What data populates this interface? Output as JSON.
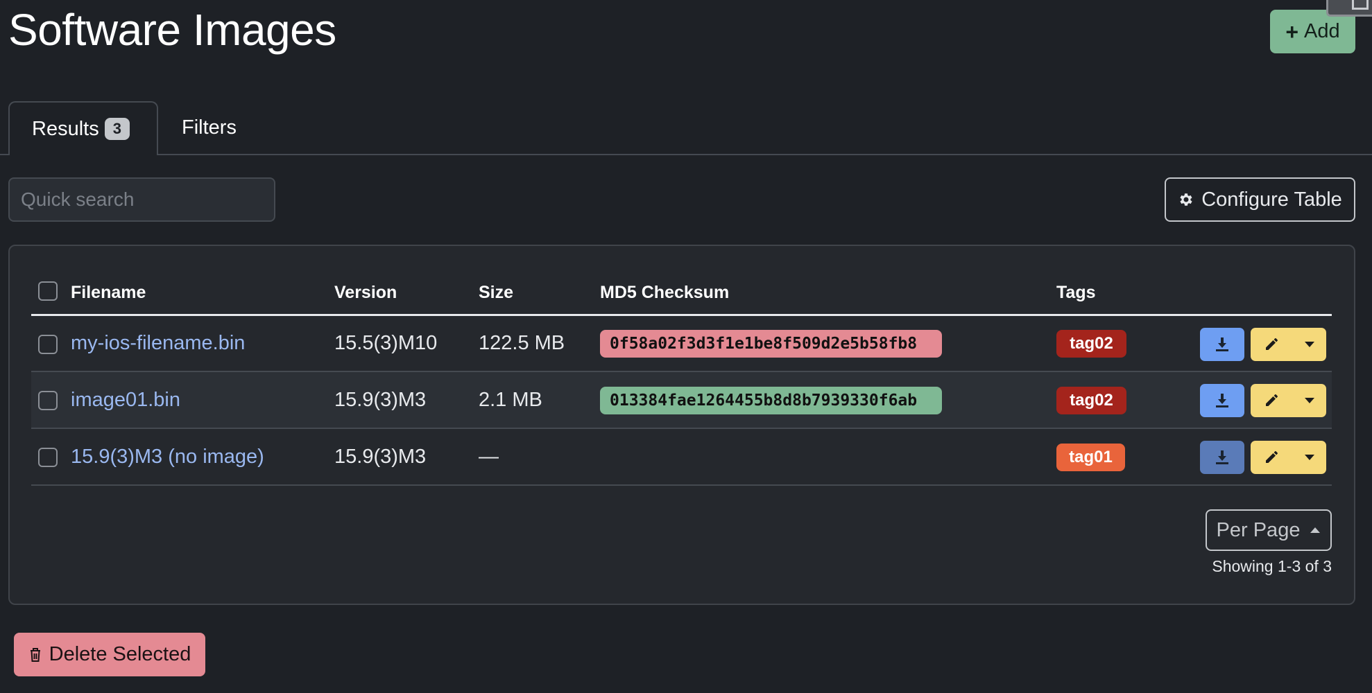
{
  "page": {
    "title": "Software Images"
  },
  "header": {
    "add_label": "Add"
  },
  "tabs": [
    {
      "label": "Results",
      "badge": "3"
    },
    {
      "label": "Filters"
    }
  ],
  "search": {
    "placeholder": "Quick search",
    "value": ""
  },
  "toolbar": {
    "configure_label": "Configure Table"
  },
  "table": {
    "columns": [
      "Filename",
      "Version",
      "Size",
      "MD5 Checksum",
      "Tags"
    ],
    "rows": [
      {
        "filename": "my-ios-filename.bin",
        "version": "15.5(3)M10",
        "size": "122.5 MB",
        "md5": "0f58a02f3d3f1e1be8f509d2e5b58fb8",
        "md5_status": "mismatch",
        "tag": "tag02",
        "tag_color": "#a4241c"
      },
      {
        "filename": "image01.bin",
        "version": "15.9(3)M3",
        "size": "2.1 MB",
        "md5": "013384fae1264455b8d8b7939330f6ab",
        "md5_status": "match",
        "tag": "tag02",
        "tag_color": "#a4241c"
      },
      {
        "filename": "15.9(3)M3 (no image)",
        "version": "15.9(3)M3",
        "size": "—",
        "md5": "",
        "md5_status": "none",
        "tag": "tag01",
        "tag_color": "#e9643b"
      }
    ]
  },
  "pagination": {
    "per_page_label": "Per Page",
    "showing": "Showing 1-3 of 3"
  },
  "footer": {
    "delete_label": "Delete Selected"
  },
  "colors": {
    "add": "#7fb894",
    "md5_mismatch": "#e48a93",
    "md5_match": "#7fb894",
    "download": "#6e9ef2",
    "download_disabled": "#5a7bb8",
    "edit": "#f5d97a",
    "delete": "#e48a93"
  },
  "icons": [
    "plus-icon",
    "gear-icon",
    "download-icon",
    "pencil-icon",
    "caret-down-icon",
    "caret-up-icon",
    "trash-icon"
  ]
}
